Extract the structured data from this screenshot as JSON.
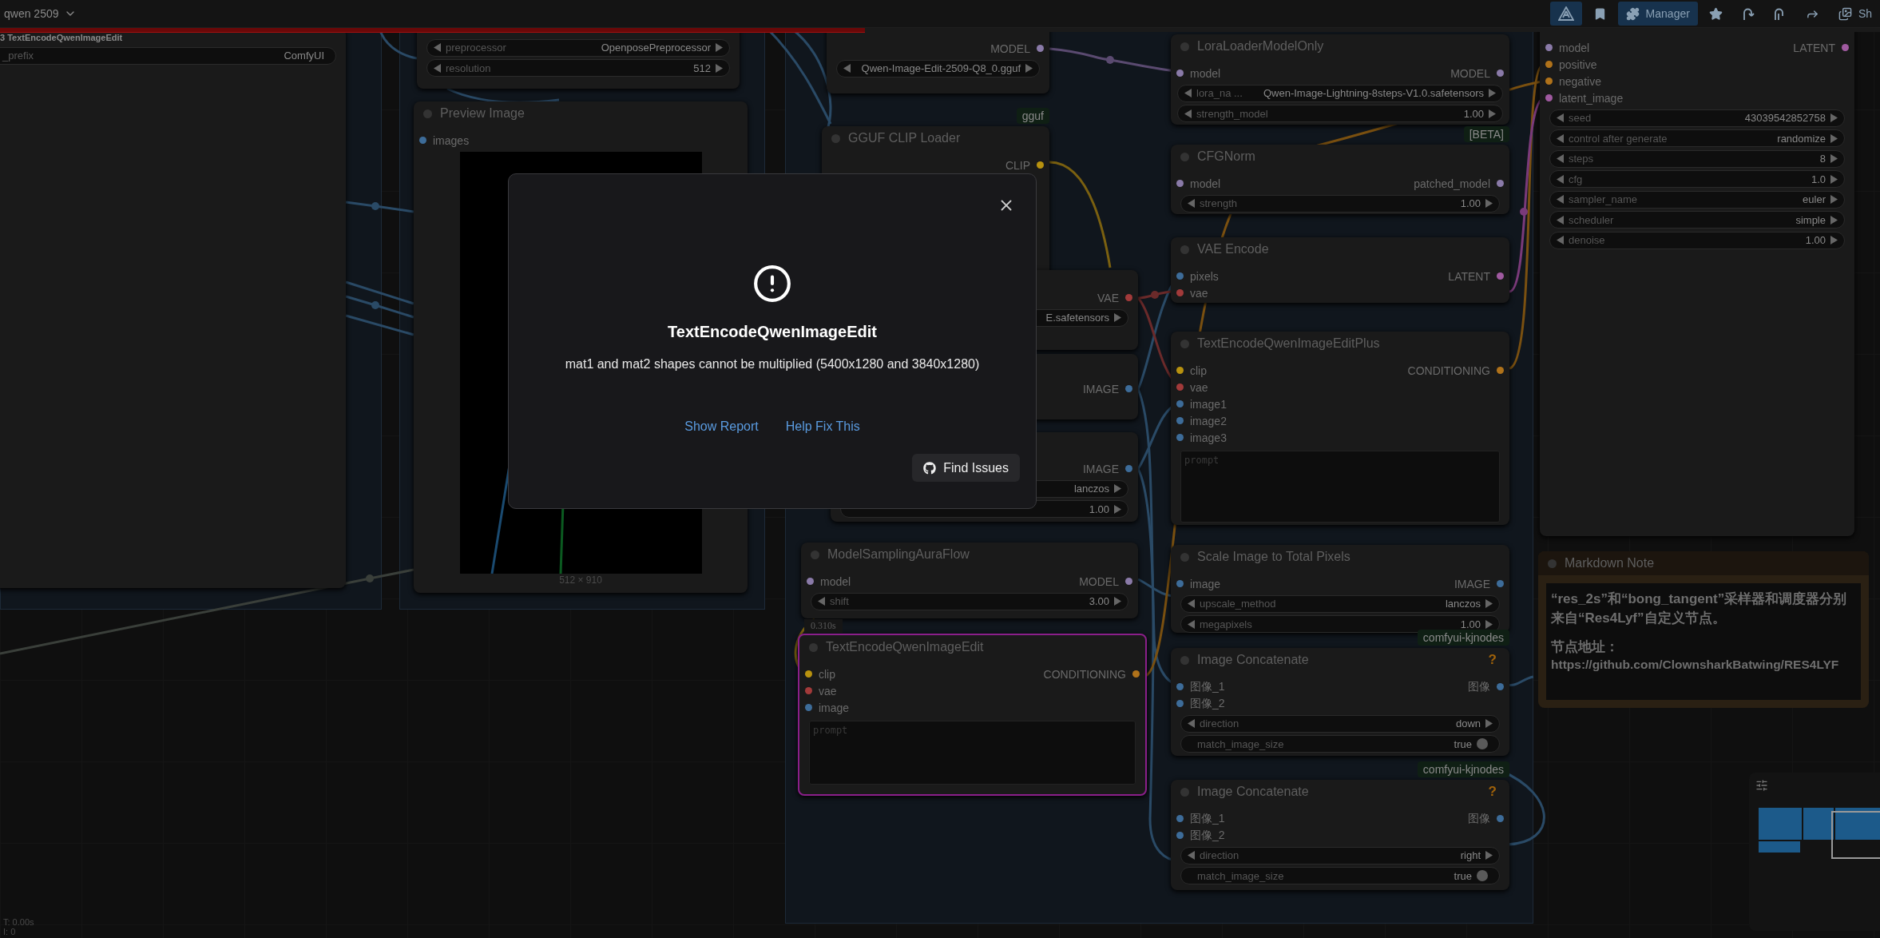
{
  "top_bar": {
    "workflow_name": "qwen 2509"
  },
  "toolbar": [
    {
      "selected": true
    },
    {
      "selected": false
    },
    {
      "label": "Manager",
      "selected": true
    },
    {
      "selected": false
    },
    {
      "selected": false
    },
    {
      "selected": false
    },
    {
      "selected": false
    },
    {
      "label": "Sh",
      "selected": false
    }
  ],
  "progress": {
    "level": 0.46,
    "label": "3 TextEncodeQwenImageEdit"
  },
  "nodes": [
    {
      "kind": "node",
      "executing": false,
      "widgets": [
        {
          "kind": "text",
          "label": "_prefix",
          "value": "ComfyUI"
        }
      ]
    },
    {
      "kind": "node",
      "executing": false,
      "widgets": [
        {
          "kind": "combo",
          "label": "preprocessor",
          "value": "OpenposePreprocessor"
        },
        {
          "kind": "number",
          "label": "resolution",
          "value": "512"
        }
      ]
    },
    {
      "kind": "node",
      "title": "Preview Image",
      "executing": false,
      "inputs": [
        {
          "name": "images",
          "color": "#3d6c99"
        }
      ],
      "image": {
        "kind": "picture",
        "caption": "512 × 910"
      }
    },
    {
      "kind": "node",
      "executing": false,
      "outputs": [
        {
          "name": "MODEL",
          "color": "#8a7aa8"
        }
      ],
      "widgets": [
        {
          "kind": "combo",
          "value": "Qwen-Image-Edit-2509-Q8_0.gguf"
        }
      ]
    },
    {
      "kind": "node",
      "title": "GGUF CLIP Loader",
      "badge": "gguf",
      "executing": false,
      "outputs": [
        {
          "name": "CLIP",
          "color": "#b8920f"
        }
      ]
    },
    {
      "kind": "node",
      "executing": false,
      "outputs": [
        {
          "name": "VAE",
          "color": "#a23a3a"
        }
      ],
      "widgets": [
        {
          "kind": "combo",
          "value": "E.safetensors"
        }
      ]
    },
    {
      "kind": "node",
      "executing": false,
      "outputs": [
        {
          "name": "IMAGE",
          "color": "#3d6c99"
        }
      ]
    },
    {
      "kind": "node",
      "executing": false,
      "outputs": [
        {
          "name": "IMAGE",
          "color": "#3d6c99"
        }
      ],
      "widgets": [
        {
          "kind": "combo",
          "value": "lanczos"
        },
        {
          "kind": "number",
          "value": "1.00"
        }
      ]
    },
    {
      "kind": "node",
      "title": "ModelSamplingAuraFlow",
      "executing": false,
      "inputs": [
        {
          "name": "model",
          "color": "#8a7aa8"
        }
      ],
      "outputs": [
        {
          "name": "MODEL",
          "color": "#8a7aa8"
        }
      ],
      "widgets": [
        {
          "kind": "number",
          "label": "shift",
          "value": "3.00"
        }
      ]
    },
    {
      "kind": "node",
      "title": "TextEncodeQwenImageEdit",
      "time": "0.310s",
      "executing": true,
      "inputs": [
        {
          "name": "clip",
          "color": "#b8920f"
        },
        {
          "name": "vae",
          "color": "#a23a3a"
        },
        {
          "name": "image",
          "color": "#3d6c99"
        }
      ],
      "outputs": [
        {
          "name": "CONDITIONING",
          "color": "#b0721a"
        }
      ],
      "prompt": {
        "placeholder": "prompt"
      }
    },
    {
      "kind": "node",
      "title": "LoraLoaderModelOnly",
      "executing": false,
      "inputs": [
        {
          "name": "model",
          "color": "#8a7aa8"
        }
      ],
      "outputs": [
        {
          "name": "MODEL",
          "color": "#8a7aa8"
        }
      ],
      "widgets": [
        {
          "kind": "combo",
          "label": "lora_na ...",
          "value": "Qwen-Image-Lightning-8steps-V1.0.safetensors"
        },
        {
          "kind": "number",
          "label": "strength_model",
          "value": "1.00"
        }
      ]
    },
    {
      "kind": "node",
      "title": "CFGNorm",
      "badge": "[BETA]",
      "executing": false,
      "inputs": [
        {
          "name": "model",
          "color": "#8a7aa8"
        }
      ],
      "outputs": [
        {
          "name": "patched_model",
          "color": "#8a7aa8"
        }
      ],
      "widgets": [
        {
          "kind": "number",
          "label": "strength",
          "value": "1.00"
        }
      ]
    },
    {
      "kind": "node",
      "title": "VAE Encode",
      "executing": false,
      "inputs": [
        {
          "name": "pixels",
          "color": "#3d6c99"
        },
        {
          "name": "vae",
          "color": "#a23a3a"
        }
      ],
      "outputs": [
        {
          "name": "LATENT",
          "color": "#a05aa0"
        }
      ]
    },
    {
      "kind": "node",
      "title": "TextEncodeQwenImageEditPlus",
      "executing": false,
      "inputs": [
        {
          "name": "clip",
          "color": "#b8920f"
        },
        {
          "name": "vae",
          "color": "#a23a3a"
        },
        {
          "name": "image1",
          "color": "#3d6c99"
        },
        {
          "name": "image2",
          "color": "#3d6c99"
        },
        {
          "name": "image3",
          "color": "#3d6c99"
        }
      ],
      "outputs": [
        {
          "name": "CONDITIONING",
          "color": "#b0721a"
        }
      ],
      "prompt": {
        "placeholder": "prompt"
      }
    },
    {
      "kind": "node",
      "title": "Scale Image to Total Pixels",
      "executing": false,
      "inputs": [
        {
          "name": "image",
          "color": "#3d6c99"
        }
      ],
      "outputs": [
        {
          "name": "IMAGE",
          "color": "#3d6c99"
        }
      ],
      "widgets": [
        {
          "kind": "combo",
          "label": "upscale_method",
          "value": "lanczos"
        },
        {
          "kind": "number",
          "label": "megapixels",
          "value": "1.00"
        }
      ]
    },
    {
      "kind": "node",
      "title": "Image Concatenate",
      "badge": "comfyui-kjnodes",
      "help": "?",
      "executing": false,
      "inputs": [
        {
          "name": "图像_1",
          "color": "#3d6c99"
        },
        {
          "name": "图像_2",
          "color": "#3d6c99"
        }
      ],
      "outputs": [
        {
          "name": "图像",
          "color": "#3d6c99"
        }
      ],
      "widgets": [
        {
          "kind": "combo",
          "label": "direction",
          "value": "down"
        },
        {
          "kind": "toggle",
          "label": "match_image_size",
          "value": "true",
          "on": true
        }
      ]
    },
    {
      "kind": "node",
      "title": "Image Concatenate",
      "badge": "comfyui-kjnodes",
      "help": "?",
      "executing": false,
      "inputs": [
        {
          "name": "图像_1",
          "color": "#3d6c99"
        },
        {
          "name": "图像_2",
          "color": "#3d6c99"
        }
      ],
      "outputs": [
        {
          "name": "图像",
          "color": "#3d6c99"
        }
      ],
      "widgets": [
        {
          "kind": "combo",
          "label": "direction",
          "value": "right"
        },
        {
          "kind": "toggle",
          "label": "match_image_size",
          "value": "true",
          "on": true
        }
      ]
    },
    {
      "kind": "node",
      "executing": false,
      "inputs": [
        {
          "name": "model",
          "color": "#8a7aa8"
        },
        {
          "name": "positive",
          "color": "#b0721a"
        },
        {
          "name": "negative",
          "color": "#b0721a"
        },
        {
          "name": "latent_image",
          "color": "#a05aa0"
        }
      ],
      "outputs": [
        {
          "name": "LATENT",
          "color": "#a05aa0"
        }
      ],
      "widgets": [
        {
          "kind": "number",
          "label": "seed",
          "value": "43039542852758"
        },
        {
          "kind": "combo",
          "label": "control after generate",
          "value": "randomize"
        },
        {
          "kind": "number",
          "label": "steps",
          "value": "8"
        },
        {
          "kind": "number",
          "label": "cfg",
          "value": "1.0"
        },
        {
          "kind": "combo",
          "label": "sampler_name",
          "value": "euler"
        },
        {
          "kind": "combo",
          "label": "scheduler",
          "value": "simple"
        },
        {
          "kind": "number",
          "label": "denoise",
          "value": "1.00"
        }
      ]
    },
    {
      "kind": "markdown",
      "title": "Markdown Note",
      "paragraph": "“res_2s”和“bong_tangent”采样器和调度器分别来自“Res4Lyf”自定义节点。",
      "address_label": "节点地址：",
      "link": "https://github.com/ClownsharkBatwing/RES4LYF"
    }
  ],
  "modal": {
    "title": "TextEncodeQwenImageEdit",
    "message": "mat1 and mat2 shapes cannot be multiplied (5400x1280 and 3840x1280)",
    "links": [
      "Show Report",
      "Help Fix This"
    ],
    "button": "Find Issues"
  },
  "stats": [
    "T: 0.00s",
    "I: 0"
  ]
}
